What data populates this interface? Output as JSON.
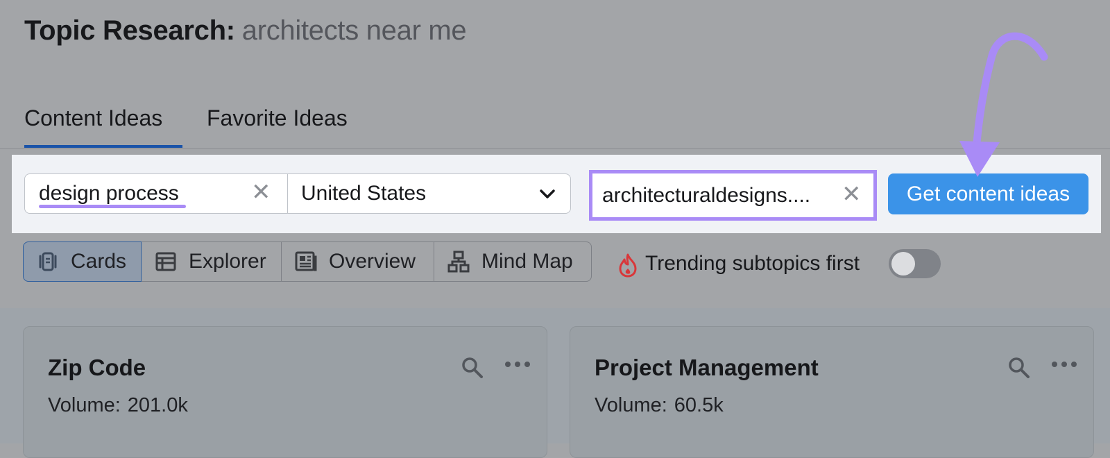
{
  "header": {
    "title_label": "Topic Research:",
    "query": "architects near me"
  },
  "tabs": [
    {
      "label": "Content Ideas",
      "active": true
    },
    {
      "label": "Favorite Ideas",
      "active": false
    }
  ],
  "search": {
    "keyword_value": "design process",
    "country_value": "United States",
    "domain_value": "architecturaldesigns....",
    "submit_label": "Get content ideas"
  },
  "views": [
    {
      "label": "Cards",
      "icon": "cards-icon",
      "active": true
    },
    {
      "label": "Explorer",
      "icon": "table-icon",
      "active": false
    },
    {
      "label": "Overview",
      "icon": "overview-icon",
      "active": false
    },
    {
      "label": "Mind Map",
      "icon": "mind-map-icon",
      "active": false
    }
  ],
  "trending": {
    "label": "Trending subtopics first",
    "enabled": false,
    "icon": "fire-icon"
  },
  "cards": [
    {
      "title": "Zip Code",
      "volume_label": "Volume:",
      "volume": "201.0k"
    },
    {
      "title": "Project Management",
      "volume_label": "Volume:",
      "volume": "60.5k"
    }
  ],
  "colors": {
    "accent": "#3b93e8",
    "highlight": "#a98bf6",
    "tab_underline": "#1a53a8",
    "fire": "#d9373a"
  }
}
